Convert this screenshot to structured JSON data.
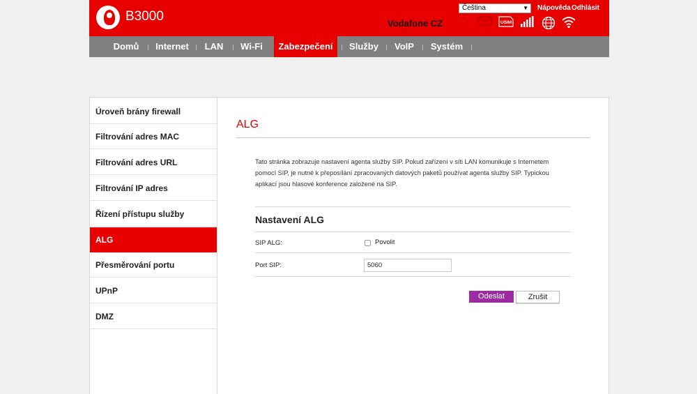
{
  "header": {
    "brand": "B3000",
    "operator": "Vodafone CZ",
    "language": "Čeština",
    "help_link": "Nápověda",
    "logout_link": "Odhlásit",
    "status_icons": [
      "mail-icon",
      "usim-icon",
      "signal-icon",
      "globe-icon",
      "wifi-icon"
    ],
    "usim_label": "USIM"
  },
  "nav": {
    "items": [
      {
        "label": "Domů"
      },
      {
        "label": "Internet"
      },
      {
        "label": "LAN"
      },
      {
        "label": "Wi-Fi"
      },
      {
        "label": "Zabezpečení"
      },
      {
        "label": "Služby"
      },
      {
        "label": "VoIP"
      },
      {
        "label": "Systém"
      }
    ],
    "active": "Zabezpečení"
  },
  "sidebar": {
    "items": [
      {
        "label": "Úroveň brány firewall"
      },
      {
        "label": "Filtrování adres MAC"
      },
      {
        "label": "Filtrování adres URL"
      },
      {
        "label": "Filtrování IP adres"
      },
      {
        "label": "Řízení přístupu služby"
      },
      {
        "label": "ALG"
      },
      {
        "label": "Přesměrování portu"
      },
      {
        "label": "UPnP"
      },
      {
        "label": "DMZ"
      }
    ],
    "active": "ALG"
  },
  "content": {
    "title": "ALG",
    "description": "Tato stránka zobrazuje nastavení agenta služby SIP. Pokud zařízení v síti LAN komunikuje s Internetem pomocí SIP, je nutné k přeposílání zpracovaných datových paketů používat agenta služby SIP. Typickou aplikací jsou hlasové konference založené na SIP.",
    "section_title": "Nastavení ALG",
    "sip_alg_label": "SIP ALG:",
    "enable_label": "Povolit",
    "sip_alg_enabled": false,
    "port_label": "Port SIP:",
    "port_value": "5060",
    "submit_label": "Odeslat",
    "cancel_label": "Zrušit"
  },
  "colors": {
    "brand_red": "#e60000",
    "nav_gray": "#808080",
    "submit_purple": "#9c2aa0"
  }
}
